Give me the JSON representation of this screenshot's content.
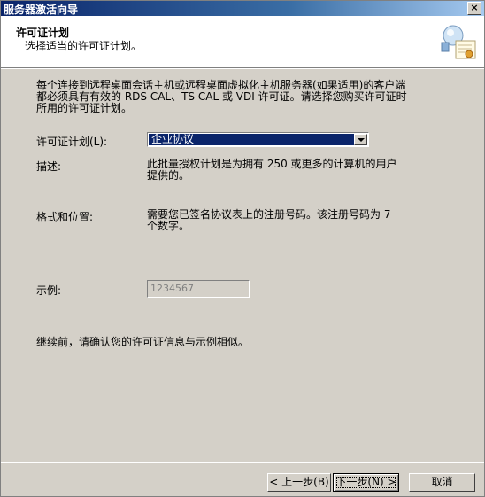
{
  "window": {
    "title": "服务器激活向导",
    "close_glyph": "×"
  },
  "header": {
    "title": "许可证计划",
    "subtitle": "选择适当的许可证计划。",
    "icon": "certificate-icon"
  },
  "intro": "每个连接到远程桌面会话主机或远程桌面虚拟化主机服务器(如果适用)的客户端都必须具有有效的 RDS CAL、TS CAL 或 VDI 许可证。请选择您购买许可证时所用的许可证计划。",
  "fields": {
    "plan_label": "许可证计划(L):",
    "plan_value": "企业协议",
    "desc_label": "描述:",
    "desc_value": "此批量授权计划是为拥有 250 或更多的计算机的用户提供的。",
    "format_label": "格式和位置:",
    "format_value": "需要您已签名协议表上的注册号码。该注册号码为 7 个数字。",
    "example_label": "示例:",
    "example_value": "1234567"
  },
  "note": "继续前，请确认您的许可证信息与示例相似。",
  "buttons": {
    "back": "< 上一步(B)",
    "next": "下一步(N) >",
    "cancel": "取消"
  }
}
